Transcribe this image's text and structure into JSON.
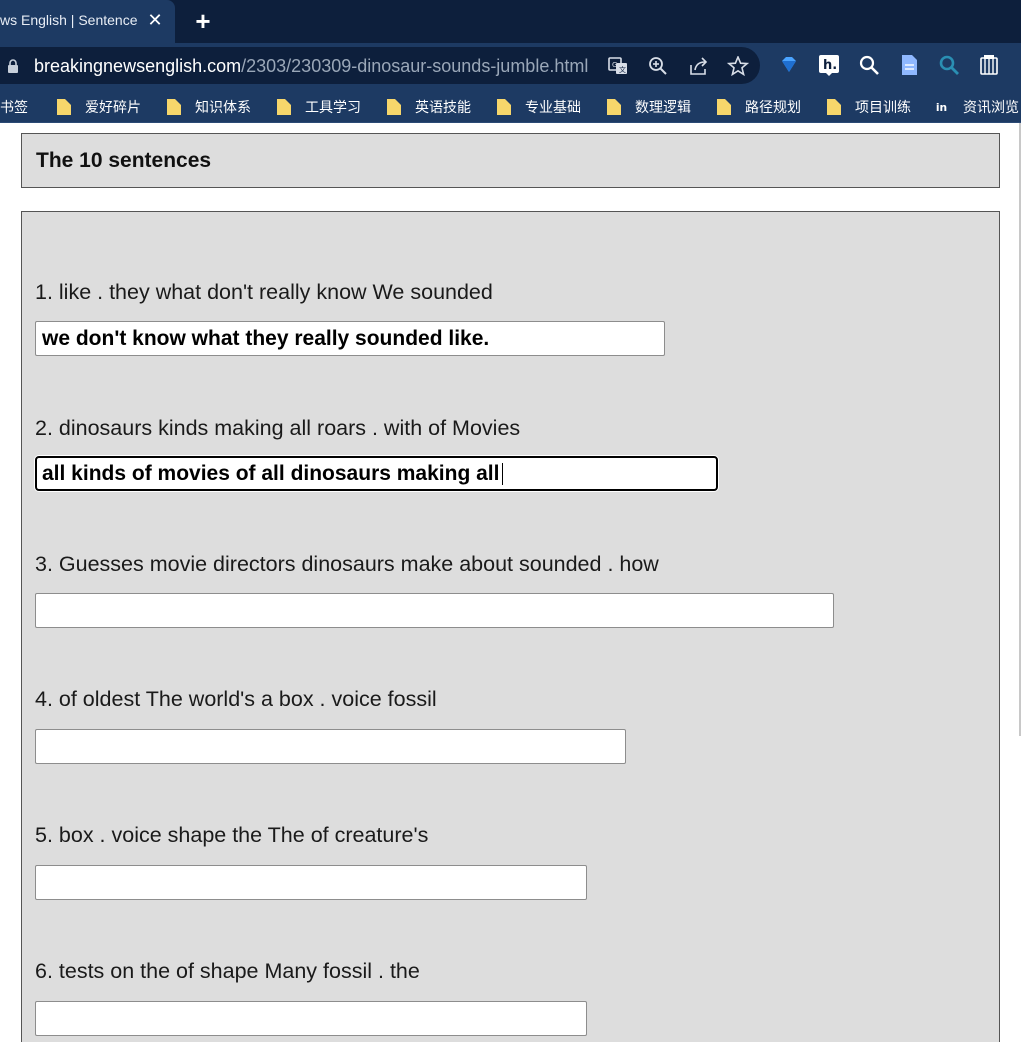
{
  "browser": {
    "tab_title": "ws English | Sentence",
    "close_symbol": "✕",
    "new_tab_symbol": "+",
    "url_host": "breakingnewsenglish.com",
    "url_path": "/2303/230309-dinosaur-sounds-jumble.html",
    "bookmarks": [
      {
        "label": "书签"
      },
      {
        "label": "爱好碎片"
      },
      {
        "label": "知识体系"
      },
      {
        "label": "工具学习"
      },
      {
        "label": "英语技能"
      },
      {
        "label": "专业基础"
      },
      {
        "label": "数理逻辑"
      },
      {
        "label": "路径规划"
      },
      {
        "label": "项目训练"
      },
      {
        "label": "资讯浏览"
      }
    ]
  },
  "page": {
    "heading": "The 10 sentences",
    "sentences": [
      {
        "prompt": "1. like . they what don't really know We sounded",
        "answer": "we don't know what they really sounded like."
      },
      {
        "prompt": "2. dinosaurs kinds making all roars . with of Movies",
        "answer": "all kinds of movies of all dinosaurs making all"
      },
      {
        "prompt": "3. Guesses movie directors dinosaurs make about sounded . how",
        "answer": ""
      },
      {
        "prompt": "4. of oldest The world's a box . voice fossil",
        "answer": ""
      },
      {
        "prompt": "5. box . voice shape the The of creature's",
        "answer": ""
      },
      {
        "prompt": "6. tests on the of shape Many fossil . the",
        "answer": ""
      }
    ]
  },
  "colors": {
    "tabbar": "#0d1f3c",
    "toolbar": "#1d3a63",
    "panel": "#dddddd",
    "folder": "#f6d66b"
  }
}
